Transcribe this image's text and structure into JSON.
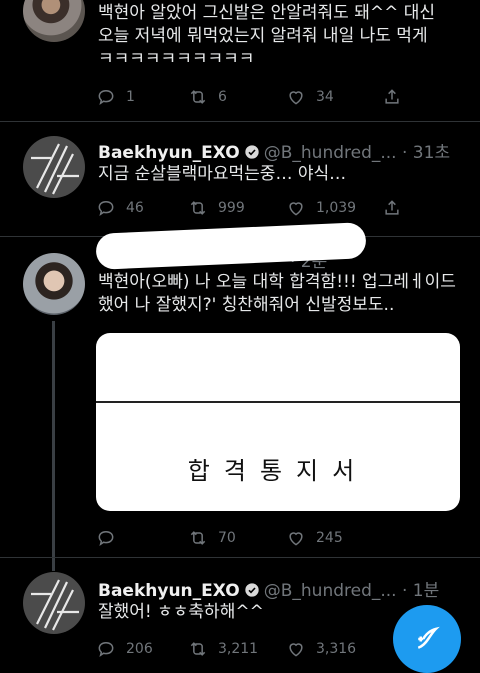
{
  "tweets": [
    {
      "text": "백현아 알았어 그신발은 안알려줘도 돼^^ 대신 오늘 저녁에 뭐먹었는지 알려줘 내일 나도 먹게 ㅋㅋㅋㅋㅋㅋㅋㅋㅋㅋ",
      "replies": "1",
      "retweets": "6",
      "likes": "34"
    },
    {
      "name": "Baekhyun_EXO",
      "handle": "@B_hundred_...",
      "time": "· 31초",
      "text": "지금 순살블랙마요먹는중… 야식…",
      "replies": "46",
      "retweets": "999",
      "likes": "1,039"
    },
    {
      "time": "· 2분",
      "text": "백현아(오빠) 나 오늘 대학 합격함!!! 업그레ㅔ이드 했어 나 잘했지?' 칭찬해줘어 신발정보도..",
      "card_text": "합격통지서",
      "replies": "",
      "retweets": "70",
      "likes": "245"
    },
    {
      "name": "Baekhyun_EXO",
      "handle": "@B_hundred_...",
      "time": "· 1분",
      "text": "잘했어! ㅎㅎ축하해^^",
      "replies": "206",
      "retweets": "3,211",
      "likes": "3,316"
    }
  ],
  "icons": {
    "reply": "reply-icon",
    "retweet": "retweet-icon",
    "like": "heart-icon",
    "share": "share-icon",
    "verified": "verified-badge-icon",
    "compose": "compose-tweet-icon"
  },
  "colors": {
    "accent": "#1d9bf0",
    "background": "#000000",
    "muted": "#71767b"
  }
}
